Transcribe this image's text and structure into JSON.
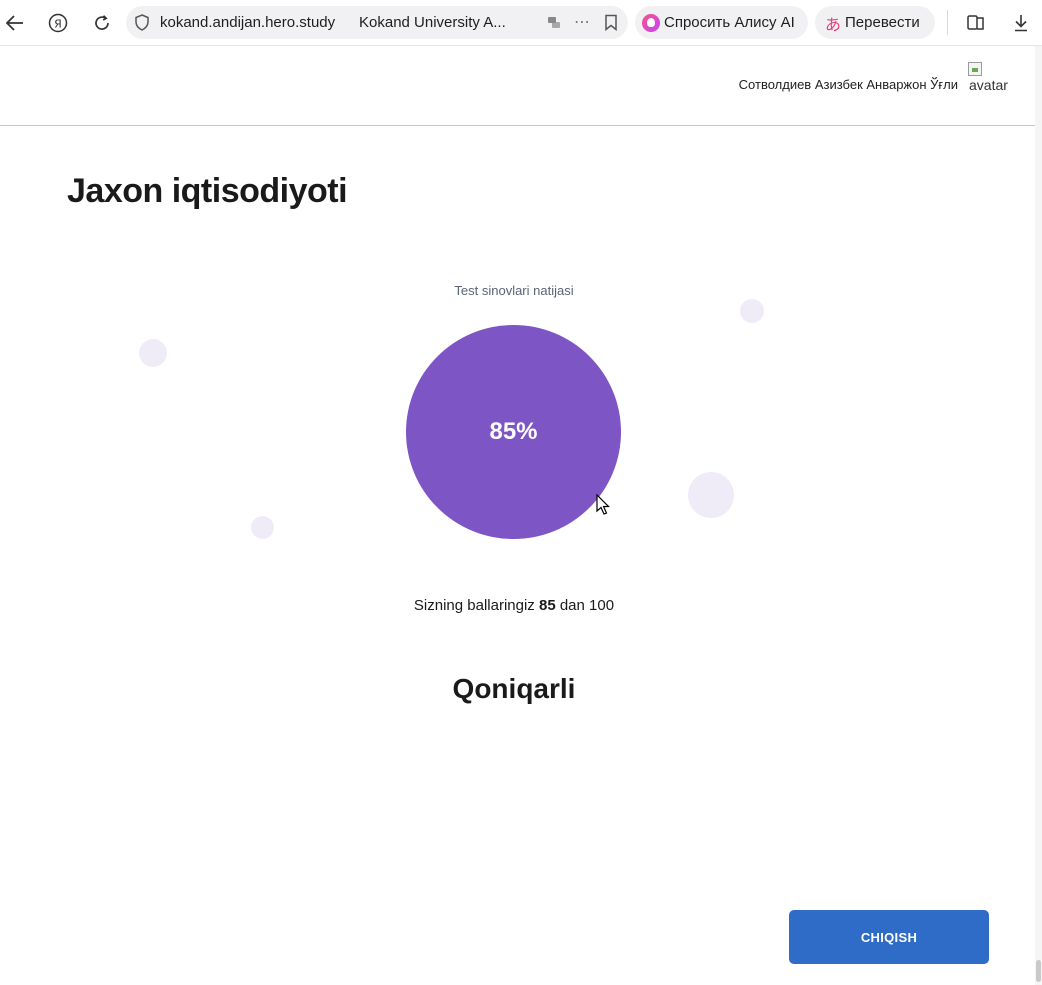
{
  "browser": {
    "url": "kokand.andijan.hero.study",
    "tab_title": "Kokand University A...",
    "alice_label": "Спросить Алису AI",
    "translate_label": "Перевести",
    "yandex_glyph": "Я"
  },
  "header": {
    "user_name": "Сотволдиев Азизбек Анваржон Ўғли",
    "avatar_alt": "avatar"
  },
  "page": {
    "title": "Jaxon iqtisodiyoti",
    "result_label": "Test sinovlari natijasi",
    "score_prefix": "Sizning ballaringiz",
    "score_value": "85",
    "score_middle": "dan",
    "score_max": "100",
    "grade": "Qoniqarli",
    "exit_label": "CHIQISH"
  },
  "chart_data": {
    "type": "pie",
    "values": [
      85
    ],
    "label": "85%",
    "color": "#7e55c5"
  },
  "colors": {
    "accent": "#7e55c5",
    "button": "#2f6cc7",
    "bubble": "#efecf8"
  }
}
